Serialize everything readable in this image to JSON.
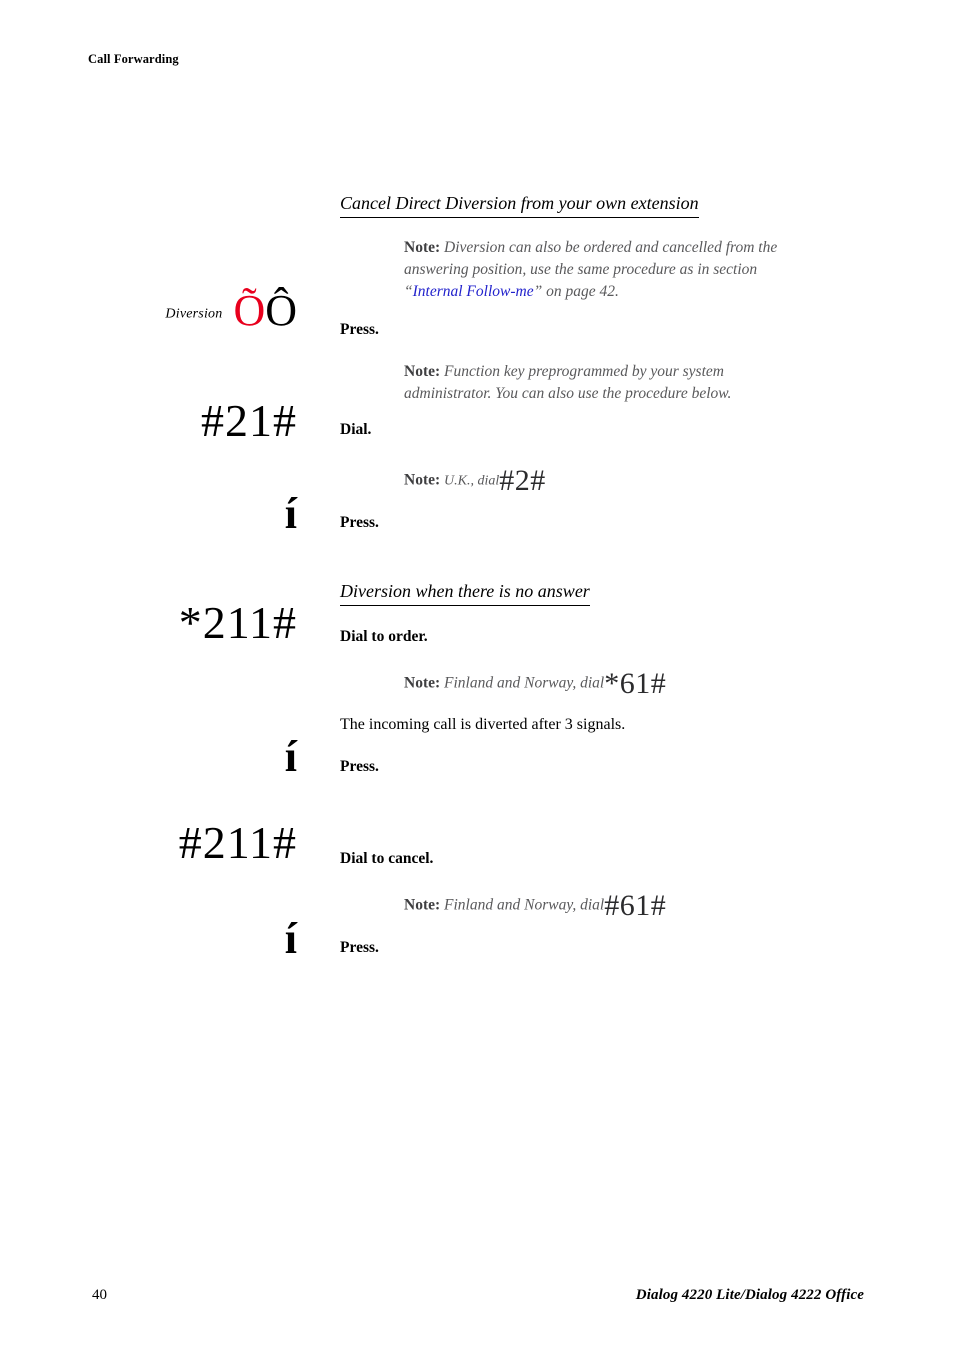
{
  "header": {
    "running_title": "Call Forwarding"
  },
  "sections": [
    {
      "heading": "Cancel Direct Diversion from your own extension",
      "note_intro_label": "Note:",
      "note_intro_line1": "Diversion can also be ordered and cancelled from the",
      "note_intro_line2": "answering position, use the same procedure as in section",
      "note_link_open_quote": "“",
      "note_link_text": "Internal Follow-me",
      "note_link_close": "” on page 42."
    },
    {
      "heading": "Diversion when there is no answer"
    }
  ],
  "steps": {
    "diversion_key": {
      "key_label": "Diversion",
      "glyph_red": "Õ",
      "glyph_black": "Ô",
      "action": "Press."
    },
    "function_key_note": {
      "label": "Note:",
      "line1": "Function key preprogrammed by your system",
      "line2": "administrator. You can also use the procedure below."
    },
    "dial_21": {
      "code": "#21#",
      "action": "Dial."
    },
    "uk_note": {
      "label": "Note:",
      "text": "U.K., dial",
      "code": "#2#"
    },
    "press_after_21": {
      "glyph": "í",
      "action": "Press."
    },
    "dial_order_211": {
      "code": "*211#",
      "action": "Dial to order."
    },
    "finland_norway_order_note": {
      "label": "Note:",
      "text": "Finland and Norway, dial",
      "code": "*61#"
    },
    "diverted_signals_text": "The incoming call is diverted after 3 signals.",
    "press_after_order": {
      "glyph": "í",
      "action": "Press."
    },
    "dial_cancel_211": {
      "code": "#211#",
      "action": "Dial to cancel."
    },
    "finland_norway_cancel_note": {
      "label": "Note:",
      "text": "Finland and Norway, dial",
      "code": "#61#"
    },
    "press_after_cancel": {
      "glyph": "í",
      "action": "Press."
    }
  },
  "footer": {
    "page_number": "40",
    "document_title": "Dialog 4220 Lite/Dialog 4222 Office"
  },
  "colors": {
    "key_red": "#e8001d",
    "link_blue": "#2222cc",
    "note_grey": "#59595b"
  }
}
